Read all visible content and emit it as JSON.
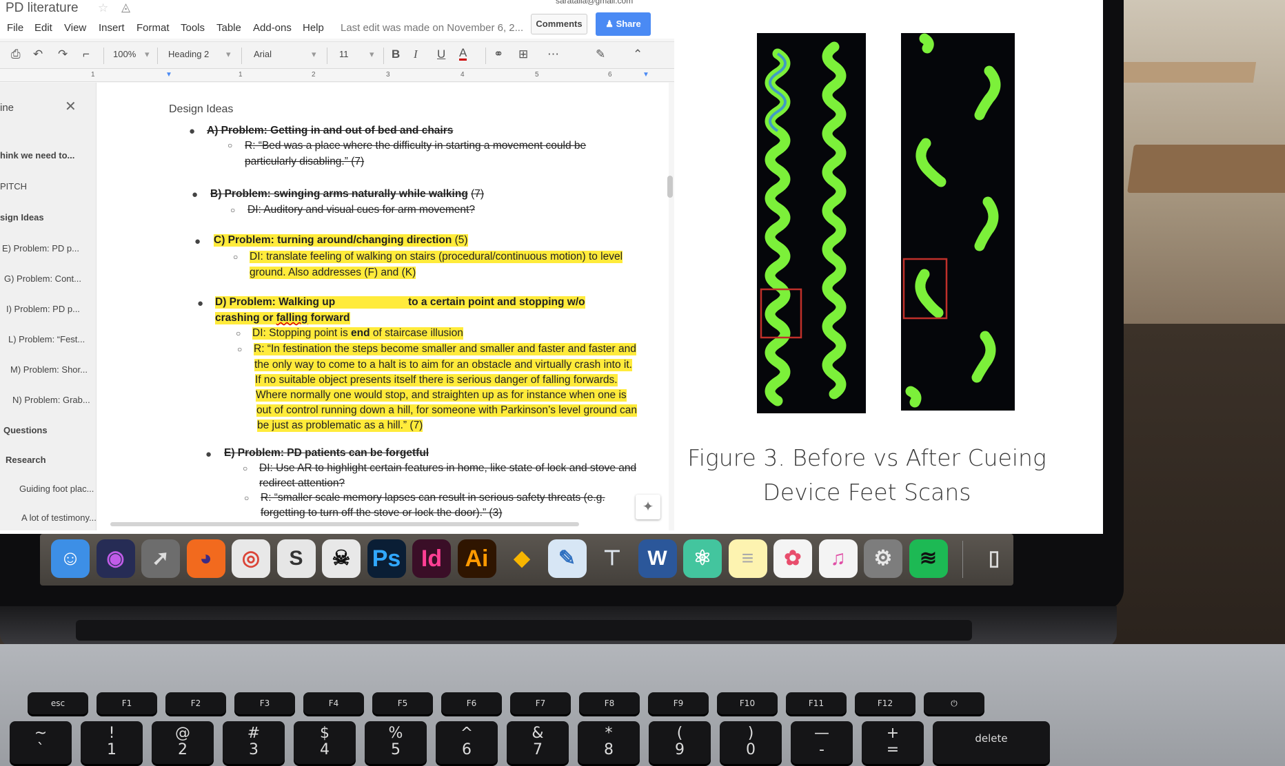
{
  "doc": {
    "title": "PD literature",
    "account": "saratalla@gmail.com",
    "menus": [
      "File",
      "Edit",
      "View",
      "Insert",
      "Format",
      "Tools",
      "Table",
      "Add-ons",
      "Help"
    ],
    "last_edit": "Last edit was made on November 6, 2...",
    "comments_label": "Comments",
    "share_label": "Share",
    "toolbar": {
      "zoom": "100%",
      "style": "Heading 2",
      "font": "Arial",
      "size": "11"
    },
    "ruler": [
      "1",
      "1",
      "2",
      "3",
      "4",
      "5",
      "6"
    ],
    "outline": [
      {
        "label": "ine",
        "bold": false
      },
      {
        "label": "hink we need to...",
        "bold": true
      },
      {
        "label": "PITCH",
        "bold": false
      },
      {
        "label": "sign Ideas",
        "bold": true
      },
      {
        "label": "E) Problem: PD p...",
        "bold": false
      },
      {
        "label": "G) Problem: Cont...",
        "bold": false
      },
      {
        "label": "I) Problem: PD p...",
        "bold": false
      },
      {
        "label": "L) Problem: “Fest...",
        "bold": false
      },
      {
        "label": "M) Problem: Shor...",
        "bold": false
      },
      {
        "label": "N) Problem: Grab...",
        "bold": false
      },
      {
        "label": "Questions",
        "bold": true
      },
      {
        "label": "Research",
        "bold": true
      },
      {
        "label": "Guiding foot plac...",
        "bold": false
      },
      {
        "label": "A lot of testimony...",
        "bold": false
      }
    ],
    "heading": "Design Ideas",
    "a": {
      "problem": "A) Problem: Getting in and out of bed and chairs",
      "r1": "R: “Bed was a place where the difficulty in starting a movement could be",
      "r2": "particularly disabling.” (7)"
    },
    "b": {
      "problem": "B) Problem: swinging arms naturally while walking",
      "count": "(7)",
      "di": "DI: Auditory and visual cues for arm movement?"
    },
    "c": {
      "problem": "C) Problem: turning around/changing direction",
      "count": "(5)",
      "di1": "DI: translate feeling of walking on stairs (procedural/continuous motion) to level",
      "di2": "ground. Also addresses (F) and (K)"
    },
    "d": {
      "problem_a": "D) Problem: Walking up",
      "problem_b": "to a certain point and stopping w/o",
      "problem_c": "crashing or",
      "problem_d": "falling",
      "problem_e": "forward",
      "di_a": "DI: Stopping point is",
      "di_b": "end",
      "di_c": "of staircase illusion",
      "r": [
        "R: “In festination the steps become smaller and smaller and faster and faster and",
        "the only way to come to a halt is to aim for an obstacle and virtually crash into it.",
        "If no suitable object presents itself there is serious danger of falling forwards.",
        "Where normally one would stop, and straighten up as for instance when one is",
        "out of control running down a hill, for someone with Parkinson’s level ground can",
        "be just as problematic as a hill.” (7)"
      ]
    },
    "e": {
      "problem": "E) Problem: PD patients can be forgetful",
      "di1": "DI: Use AR to highlight certain features in home, like state of lock and stove and",
      "di2": "redirect attention?",
      "r1": "R: “smaller scale memory lapses can result in serious safety threats (e.g.",
      "r2": "forgetting to turn off the stove or lock the door).” (3)"
    }
  },
  "figure": {
    "caption_line1": "Figure 3. Before vs After Cueing",
    "caption_line2": "Device Feet Scans"
  },
  "dock": {
    "apps": [
      {
        "name": "finder-icon",
        "glyph": "☺",
        "bg": "#3d8fe6",
        "fg": "#fff"
      },
      {
        "name": "siri-icon",
        "glyph": "◉",
        "bg": "#262c55",
        "fg": "#c05ce8"
      },
      {
        "name": "launchpad-icon",
        "glyph": "➚",
        "bg": "#6d6d6d",
        "fg": "#ddd"
      },
      {
        "name": "firefox-icon",
        "glyph": "◕",
        "bg": "#f26a1e",
        "fg": "#3b2b85"
      },
      {
        "name": "chrome-icon",
        "glyph": "◎",
        "bg": "#e8e8e8",
        "fg": "#db4437"
      },
      {
        "name": "scrivener-icon",
        "glyph": "S",
        "bg": "#e6e6e6",
        "fg": "#333"
      },
      {
        "name": "skull-app-icon",
        "glyph": "☠",
        "bg": "#e8e8e8",
        "fg": "#111"
      },
      {
        "name": "photoshop-icon",
        "glyph": "Ps",
        "bg": "#0a1e35",
        "fg": "#31a8ff"
      },
      {
        "name": "indesign-icon",
        "glyph": "Id",
        "bg": "#3a0e27",
        "fg": "#ff3f94"
      },
      {
        "name": "illustrator-icon",
        "glyph": "Ai",
        "bg": "#2f1500",
        "fg": "#ff9a00"
      },
      {
        "name": "sketch-icon",
        "glyph": "◆",
        "bg": "transparent",
        "fg": "#f7b500"
      },
      {
        "name": "preview-icon",
        "glyph": "✎",
        "bg": "#d7e6f5",
        "fg": "#2f70c0"
      },
      {
        "name": "keynote-icon",
        "glyph": "⊤",
        "bg": "transparent",
        "fg": "#dfe6ee"
      },
      {
        "name": "word-icon",
        "glyph": "W",
        "bg": "#2b579a",
        "fg": "#fff"
      },
      {
        "name": "atom-icon",
        "glyph": "⚛",
        "bg": "#43c59e",
        "fg": "#fff"
      },
      {
        "name": "notes-icon",
        "glyph": "≡",
        "bg": "#fdf3b0",
        "fg": "#aaa"
      },
      {
        "name": "photos-icon",
        "glyph": "✿",
        "bg": "#f4f4f4",
        "fg": "#e84d6c"
      },
      {
        "name": "itunes-icon",
        "glyph": "♫",
        "bg": "#f4f4f4",
        "fg": "#e04fa6"
      },
      {
        "name": "system-preferences-icon",
        "glyph": "⚙",
        "bg": "#7d7d7d",
        "fg": "#e8e8e8"
      },
      {
        "name": "spotify-icon",
        "glyph": "≋",
        "bg": "#1db954",
        "fg": "#111"
      },
      {
        "name": "trash-icon",
        "glyph": "▯",
        "bg": "transparent",
        "fg": "#dcdcdc"
      }
    ]
  },
  "keyboard": {
    "fkeys": [
      "esc",
      "F1",
      "F2",
      "F3",
      "F4",
      "F5",
      "F6",
      "F7",
      "F8",
      "F9",
      "F10",
      "F11",
      "F12",
      "⏻"
    ],
    "numkeys": [
      {
        "top": "~",
        "bot": "`"
      },
      {
        "top": "!",
        "bot": "1"
      },
      {
        "top": "@",
        "bot": "2"
      },
      {
        "top": "#",
        "bot": "3"
      },
      {
        "top": "$",
        "bot": "4"
      },
      {
        "top": "%",
        "bot": "5"
      },
      {
        "top": "^",
        "bot": "6"
      },
      {
        "top": "&",
        "bot": "7"
      },
      {
        "top": "*",
        "bot": "8"
      },
      {
        "top": "(",
        "bot": "9"
      },
      {
        "top": ")",
        "bot": "0"
      },
      {
        "top": "—",
        "bot": "-"
      },
      {
        "top": "+",
        "bot": "="
      }
    ],
    "delete": "delete"
  },
  "colors": {
    "highlight": "#ffeb3b",
    "share": "#4a8af4",
    "scan_green": "#7cf03a"
  }
}
